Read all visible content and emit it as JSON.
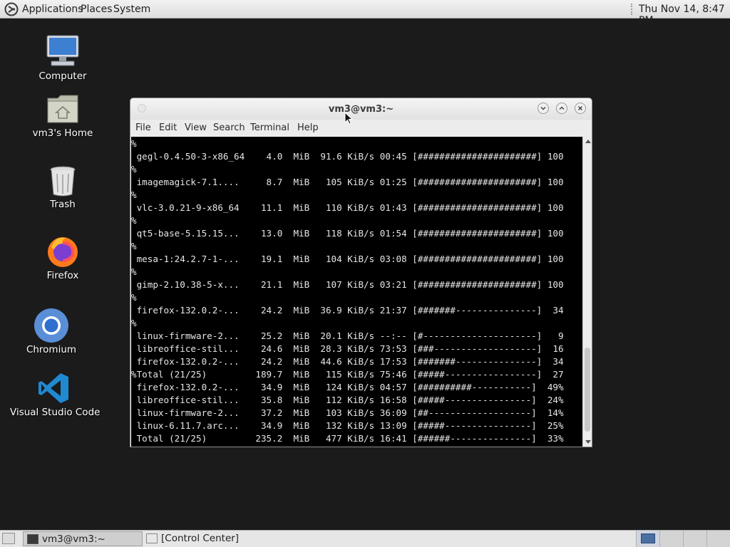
{
  "top_panel": {
    "menus": [
      "Applications",
      "Places",
      "System"
    ],
    "clock": "Thu Nov 14,  8:47 PM"
  },
  "desktop": {
    "icons": [
      {
        "label": "Computer",
        "icon": "computer-icon"
      },
      {
        "label": "vm3's Home",
        "icon": "home-folder-icon"
      },
      {
        "label": "Trash",
        "icon": "trash-icon"
      },
      {
        "label": "Firefox",
        "icon": "firefox-icon"
      },
      {
        "label": "Chromium",
        "icon": "chromium-icon"
      },
      {
        "label": "Visual Studio Code",
        "icon": "vscode-icon"
      }
    ]
  },
  "terminal": {
    "title": "vm3@vm3:~",
    "menu": [
      "File",
      "Edit",
      "View",
      "Search",
      "Terminal",
      "Help"
    ],
    "lines": [
      "%",
      " gegl-0.4.50-3-x86_64    4.0  MiB  91.6 KiB/s 00:45 [######################] 100",
      "%",
      " imagemagick-7.1....     8.7  MiB   105 KiB/s 01:25 [######################] 100",
      "%",
      " vlc-3.0.21-9-x86_64    11.1  MiB   110 KiB/s 01:43 [######################] 100",
      "%",
      " qt5-base-5.15.15...    13.0  MiB   118 KiB/s 01:54 [######################] 100",
      "%",
      " mesa-1:24.2.7-1-...    19.1  MiB   104 KiB/s 03:08 [######################] 100",
      "%",
      " gimp-2.10.38-5-x...    21.1  MiB   107 KiB/s 03:21 [######################] 100",
      "%",
      " firefox-132.0.2-...    24.2  MiB  36.9 KiB/s 21:37 [#######---------------]  34",
      "%",
      " linux-firmware-2...    25.2  MiB  20.1 KiB/s --:-- [#---------------------]   9",
      " libreoffice-stil...    24.6  MiB  28.3 KiB/s 73:53 [###-------------------]  16",
      " firefox-132.0.2-...    24.2  MiB  44.6 KiB/s 17:53 [#######---------------]  34",
      "%Total (21/25)         189.7  MiB   115 KiB/s 75:46 [#####-----------------]  27",
      " firefox-132.0.2-...    34.9  MiB   124 KiB/s 04:57 [##########-----------]  49%",
      " libreoffice-stil...    35.8  MiB   112 KiB/s 16:58 [#####----------------]  24%",
      " linux-firmware-2...    37.2  MiB   103 KiB/s 36:09 [##-------------------]  14%",
      " linux-6.11.7.arc...    34.9  MiB   132 KiB/s 13:09 [#####----------------]  25%",
      " Total (21/25)         235.2  MiB   477 KiB/s 16:41 [######---------------]  33%"
    ]
  },
  "taskbar": {
    "tasks": [
      "vm3@vm3:~",
      "[Control Center]"
    ]
  }
}
